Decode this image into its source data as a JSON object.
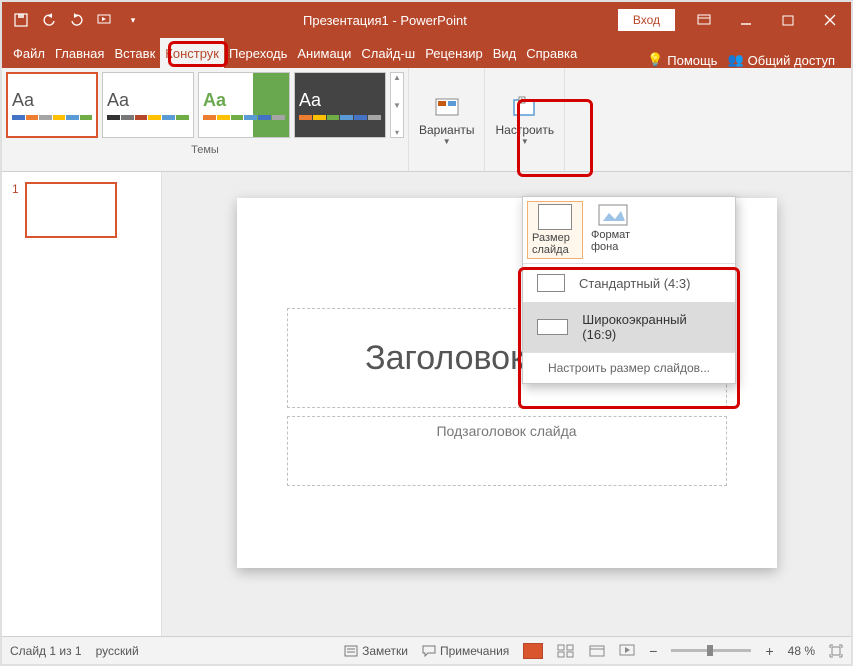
{
  "title": "Презентация1 - PowerPoint",
  "login": "Вход",
  "tabs": {
    "file": "Файл",
    "home": "Главная",
    "insert": "Вставк",
    "design": "Конструк",
    "transitions": "Переходь",
    "animations": "Анимаци",
    "slideshow": "Слайд-ш",
    "review": "Рецензир",
    "view": "Вид",
    "help": "Справка"
  },
  "tabs_right": {
    "tellme": "Помощь",
    "share": "Общий доступ"
  },
  "ribbon": {
    "themes_label": "Темы",
    "variants": "Варианты",
    "setup": "Настроить"
  },
  "size_panel": {
    "size_btn": "Размер слайда",
    "bg_btn": "Формат фона",
    "standard": "Стандартный (4:3)",
    "wide": "Широкоэкранный (16:9)",
    "custom": "Настроить размер слайдов..."
  },
  "slide": {
    "title": "Заголовок слайда",
    "subtitle": "Подзаголовок слайда"
  },
  "thumb_num": "1",
  "status": {
    "slide": "Слайд 1 из 1",
    "lang": "русский",
    "notes": "Заметки",
    "comments": "Примечания",
    "zoom": "48 %",
    "minus": "−",
    "plus": "+"
  },
  "icons": {
    "save": "💾",
    "bulb": "💡",
    "share": "👥"
  }
}
